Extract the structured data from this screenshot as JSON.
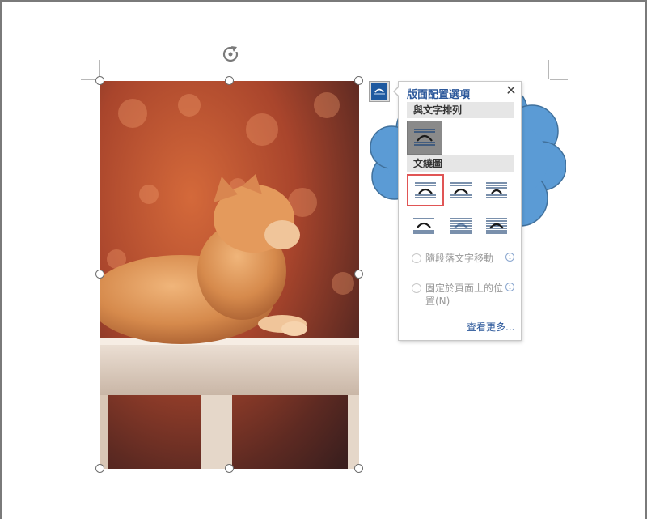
{
  "popup": {
    "title": "版面配置選項",
    "close_label": "✕",
    "section_inline": "與文字排列",
    "section_wrap": "文繞圖",
    "move_with_text": "隨段落文字移動",
    "fix_position_line1": "固定於頁面上的位",
    "fix_position_line2": "置(N)",
    "see_more": "查看更多..."
  },
  "colors": {
    "accent": "#2b579a",
    "cloud": "#5b9bd5",
    "cloud_outline": "#41719c",
    "selected_outline": "#e05555"
  },
  "icons": {
    "rotate": "rotate-icon",
    "layout_options": "layout-options-icon",
    "info": "info-icon",
    "close": "close-icon"
  }
}
